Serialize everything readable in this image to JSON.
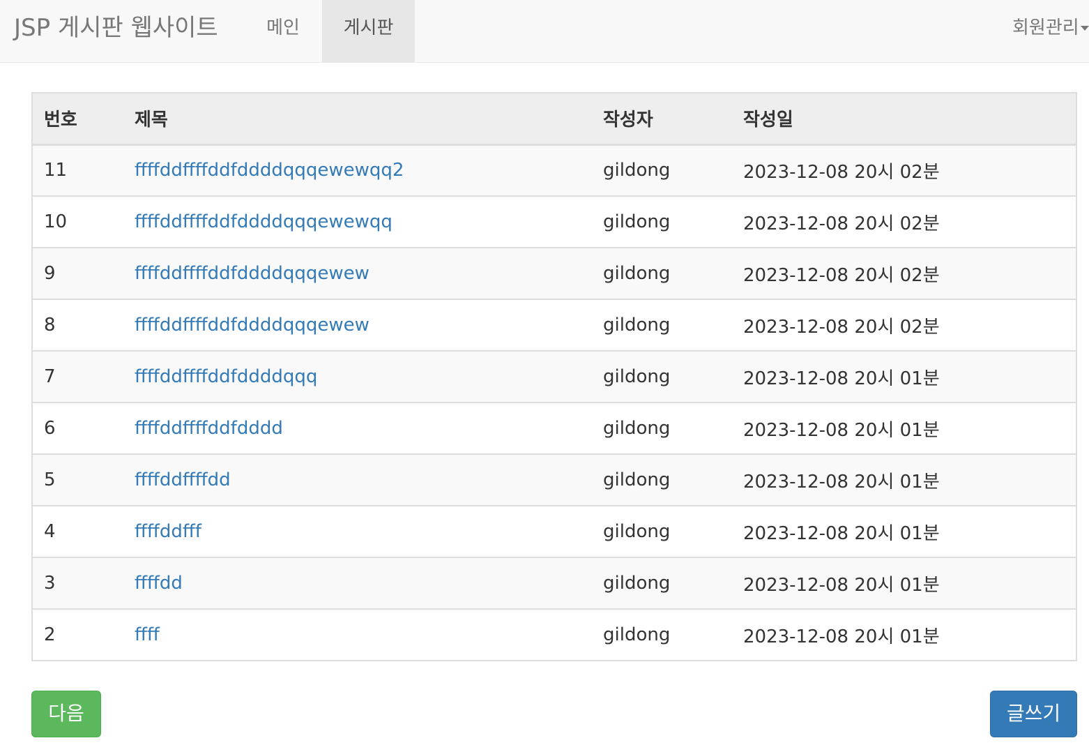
{
  "navbar": {
    "brand": "JSP 게시판 웹사이트",
    "menu": [
      {
        "label": "메인",
        "active": false
      },
      {
        "label": "게시판",
        "active": true
      }
    ],
    "member_menu": "회원관리"
  },
  "table": {
    "headers": [
      "번호",
      "제목",
      "작성자",
      "작성일"
    ],
    "rows": [
      {
        "no": "11",
        "title": "ffffddffffddfddddqqqewewqq2",
        "author": "gildong",
        "date": "2023-12-08 20시 02분"
      },
      {
        "no": "10",
        "title": "ffffddffffddfddddqqqewewqq",
        "author": "gildong",
        "date": "2023-12-08 20시 02분"
      },
      {
        "no": "9",
        "title": "ffffddffffddfddddqqqewew",
        "author": "gildong",
        "date": "2023-12-08 20시 02분"
      },
      {
        "no": "8",
        "title": "ffffddffffddfddddqqqewew",
        "author": "gildong",
        "date": "2023-12-08 20시 02분"
      },
      {
        "no": "7",
        "title": "ffffddffffddfddddqqq",
        "author": "gildong",
        "date": "2023-12-08 20시 01분"
      },
      {
        "no": "6",
        "title": "ffffddffffddfdddd",
        "author": "gildong",
        "date": "2023-12-08 20시 01분"
      },
      {
        "no": "5",
        "title": "ffffddffffdd",
        "author": "gildong",
        "date": "2023-12-08 20시 01분"
      },
      {
        "no": "4",
        "title": "ffffddfff",
        "author": "gildong",
        "date": "2023-12-08 20시 01분"
      },
      {
        "no": "3",
        "title": "ffffdd",
        "author": "gildong",
        "date": "2023-12-08 20시 01분"
      },
      {
        "no": "2",
        "title": "ffff",
        "author": "gildong",
        "date": "2023-12-08 20시 01분"
      }
    ]
  },
  "buttons": {
    "next_label": "다음",
    "write_label": "글쓰기"
  },
  "colors": {
    "link": "#337ab7",
    "success": "#5cb85c",
    "primary": "#337ab7"
  }
}
